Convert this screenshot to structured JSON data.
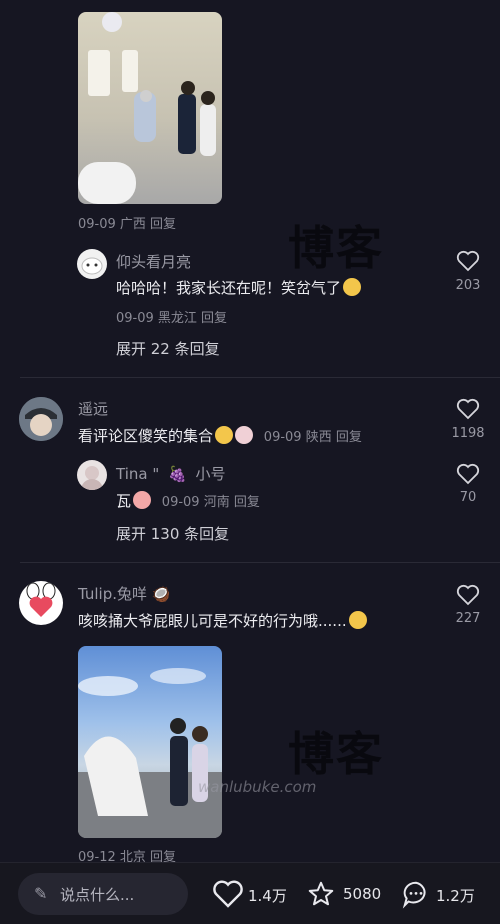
{
  "comments": [
    {
      "meta": "09-09 广西 回复"
    },
    {
      "user": "仰头看月亮",
      "text": "哈哈哈！我家长还在呢！笑岔气了",
      "meta": "09-09 黑龙江 回复",
      "likes": "203",
      "expand": "展开 22 条回复"
    },
    {
      "user": "遥远",
      "text": "看评论区傻笑的集合",
      "meta": "09-09 陕西 回复",
      "likes": "1198"
    },
    {
      "user": "Tina \"",
      "tag": "小号",
      "text": "瓦",
      "meta": "09-09 河南 回复",
      "likes": "70",
      "expand": "展开 130 条回复"
    },
    {
      "user": "Tulip.兔咩",
      "text": "咳咳捅大爷屁眼儿可是不好的行为哦......",
      "likes": "227",
      "meta": "09-12 北京 回复"
    }
  ],
  "watermark": {
    "text": "博客",
    "url": "wanlubuke.com"
  },
  "bottom_bar": {
    "input_placeholder": "说点什么...",
    "likes": "1.4万",
    "favorites": "5080",
    "comments": "1.2万"
  }
}
